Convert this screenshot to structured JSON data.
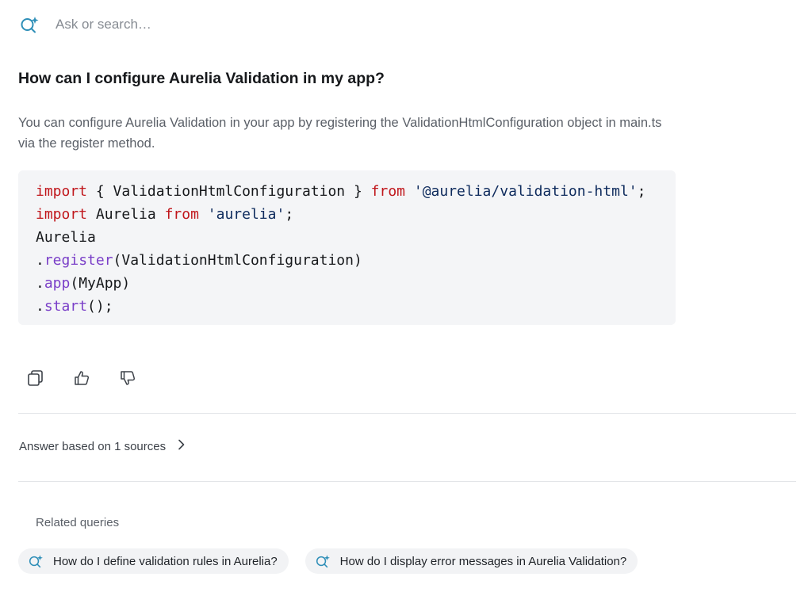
{
  "search": {
    "placeholder": "Ask or search…",
    "icon": "ai-search-icon"
  },
  "question": "How can I configure Aurelia Validation in my app?",
  "answer": "You can configure Aurelia Validation in your app by registering the ValidationHtmlConfiguration object in main.ts via the register method.",
  "code": {
    "lines": [
      [
        {
          "t": "import",
          "c": "kw"
        },
        {
          "t": " { ValidationHtmlConfiguration } ",
          "c": ""
        },
        {
          "t": "from",
          "c": "kw"
        },
        {
          "t": " ",
          "c": ""
        },
        {
          "t": "'@aurelia/validation-html'",
          "c": "str"
        },
        {
          "t": ";",
          "c": ""
        }
      ],
      [
        {
          "t": "import",
          "c": "kw"
        },
        {
          "t": " Aurelia ",
          "c": ""
        },
        {
          "t": "from",
          "c": "kw"
        },
        {
          "t": " ",
          "c": ""
        },
        {
          "t": "'aurelia'",
          "c": "str"
        },
        {
          "t": ";",
          "c": ""
        }
      ],
      [
        {
          "t": "Aurelia",
          "c": ""
        }
      ],
      [
        {
          "t": ".",
          "c": ""
        },
        {
          "t": "register",
          "c": "fn"
        },
        {
          "t": "(ValidationHtmlConfiguration)",
          "c": ""
        }
      ],
      [
        {
          "t": ".",
          "c": ""
        },
        {
          "t": "app",
          "c": "fn"
        },
        {
          "t": "(MyApp)",
          "c": ""
        }
      ],
      [
        {
          "t": ".",
          "c": ""
        },
        {
          "t": "start",
          "c": "fn"
        },
        {
          "t": "();",
          "c": ""
        }
      ]
    ]
  },
  "actions": {
    "icons": [
      "copy-icon",
      "thumbs-up-icon",
      "thumbs-down-icon"
    ]
  },
  "sources": {
    "label": "Answer based on 1 sources"
  },
  "related": {
    "title": "Related queries",
    "queries": [
      "How do I define validation rules in Aurelia?",
      "How do I display error messages in Aurelia Validation?"
    ]
  },
  "colors": {
    "accent": "#2f8fb8",
    "keyword": "#c0161b",
    "string": "#0d2a5c",
    "function": "#7a3fc8"
  }
}
